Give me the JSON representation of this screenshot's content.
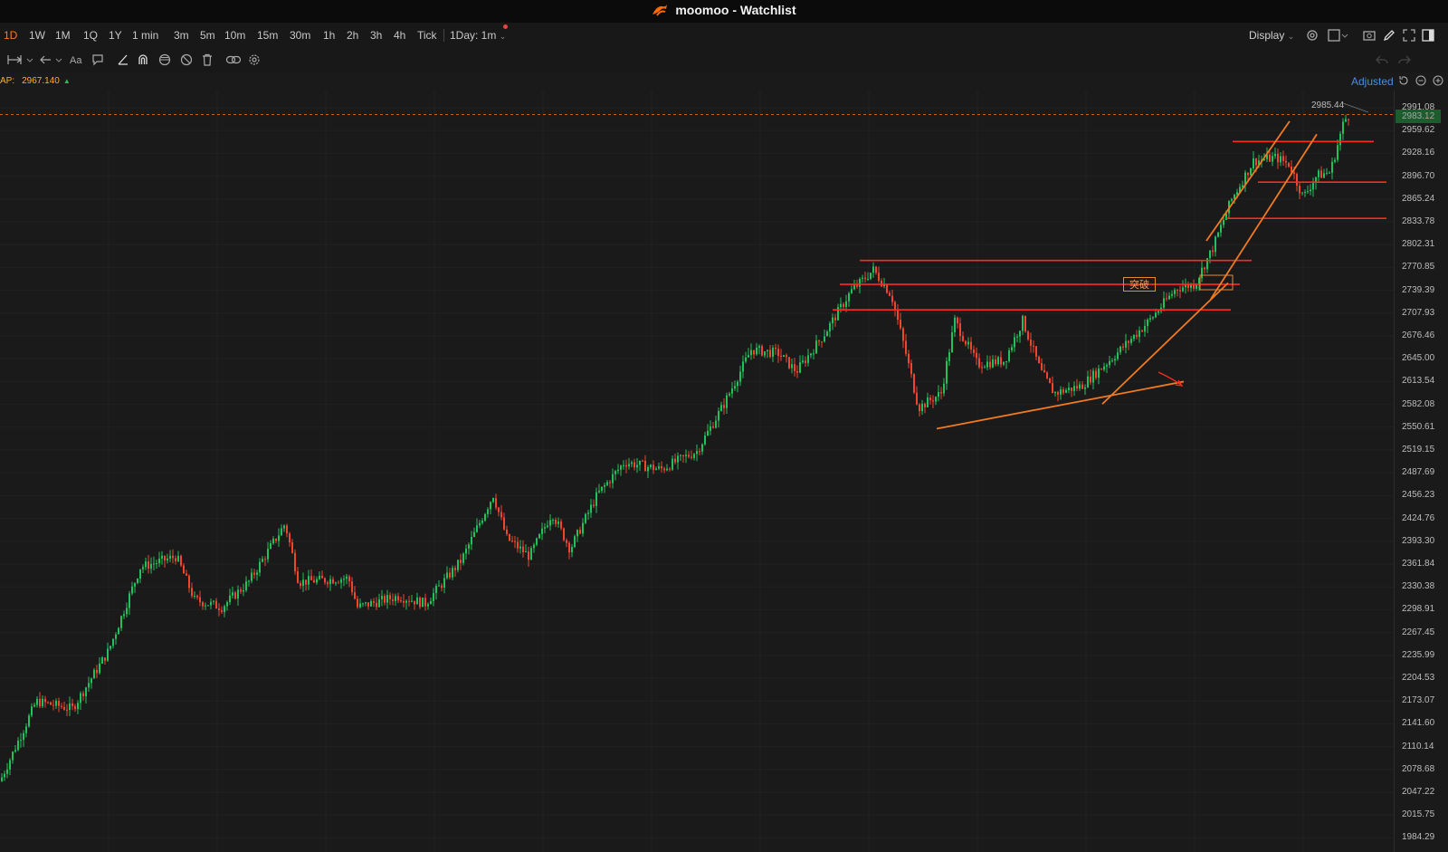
{
  "window": {
    "app_name": "moomoo",
    "title": "moomoo - Watchlist"
  },
  "timeframes": [
    {
      "label": "1D",
      "active": true
    },
    {
      "label": "1W"
    },
    {
      "label": "1M"
    },
    {
      "label": "1Q"
    },
    {
      "label": "1Y"
    },
    {
      "label": "1 min"
    },
    {
      "label": "3m"
    },
    {
      "label": "5m"
    },
    {
      "label": "10m"
    },
    {
      "label": "15m"
    },
    {
      "label": "30m"
    },
    {
      "label": "1h"
    },
    {
      "label": "2h"
    },
    {
      "label": "3h"
    },
    {
      "label": "4h"
    },
    {
      "label": "Tick"
    }
  ],
  "interval_select": {
    "label": "1Day: 1m"
  },
  "display_menu": {
    "label": "Display"
  },
  "drawing_tools": [
    "measure-icon",
    "arrow-icon",
    "text-icon",
    "comment-icon",
    "trendline-icon",
    "magnet-icon",
    "channel-icon",
    "hide-icon",
    "delete-icon",
    "link-icon",
    "settings-icon"
  ],
  "indicator": {
    "label": "AP:",
    "value": "2967.140",
    "direction": "up"
  },
  "adjust_label": "Adjusted",
  "price_axis": {
    "ticks": [
      "2991.08",
      "2959.62",
      "2928.16",
      "2896.70",
      "2865.24",
      "2833.78",
      "2802.31",
      "2770.85",
      "2739.39",
      "2707.93",
      "2676.46",
      "2645.00",
      "2613.54",
      "2582.08",
      "2550.61",
      "2519.15",
      "2487.69",
      "2456.23",
      "2424.76",
      "2393.30",
      "2361.84",
      "2330.38",
      "2298.91",
      "2267.45",
      "2235.99",
      "2204.53",
      "2173.07",
      "2141.60",
      "2110.14",
      "2078.68",
      "2047.22",
      "2015.75",
      "1984.29"
    ],
    "last_price": "2983.12",
    "high_marker": "2985.44"
  },
  "annotation": {
    "text": "突破"
  },
  "colors": {
    "up": "#21c25c",
    "down": "#f0462e",
    "trendline": "#f07a20",
    "support": "#ff2a1f",
    "accent": "#ff7a1a"
  },
  "chart_data": {
    "type": "candlestick",
    "ylim": [
      1984.29,
      2991.08
    ],
    "grid": true,
    "price_path": [
      {
        "x": 0,
        "y": 2065
      },
      {
        "x": 40,
        "y": 2175
      },
      {
        "x": 80,
        "y": 2165
      },
      {
        "x": 120,
        "y": 2245
      },
      {
        "x": 155,
        "y": 2360
      },
      {
        "x": 195,
        "y": 2375
      },
      {
        "x": 215,
        "y": 2315
      },
      {
        "x": 245,
        "y": 2305
      },
      {
        "x": 275,
        "y": 2340
      },
      {
        "x": 315,
        "y": 2420
      },
      {
        "x": 330,
        "y": 2340
      },
      {
        "x": 385,
        "y": 2345
      },
      {
        "x": 395,
        "y": 2305
      },
      {
        "x": 440,
        "y": 2320
      },
      {
        "x": 470,
        "y": 2310
      },
      {
        "x": 510,
        "y": 2370
      },
      {
        "x": 545,
        "y": 2460
      },
      {
        "x": 560,
        "y": 2400
      },
      {
        "x": 585,
        "y": 2375
      },
      {
        "x": 610,
        "y": 2435
      },
      {
        "x": 630,
        "y": 2385
      },
      {
        "x": 660,
        "y": 2460
      },
      {
        "x": 690,
        "y": 2505
      },
      {
        "x": 730,
        "y": 2495
      },
      {
        "x": 770,
        "y": 2520
      },
      {
        "x": 800,
        "y": 2585
      },
      {
        "x": 830,
        "y": 2660
      },
      {
        "x": 860,
        "y": 2655
      },
      {
        "x": 880,
        "y": 2630
      },
      {
        "x": 910,
        "y": 2680
      },
      {
        "x": 940,
        "y": 2740
      },
      {
        "x": 965,
        "y": 2770
      },
      {
        "x": 985,
        "y": 2735
      },
      {
        "x": 1000,
        "y": 2660
      },
      {
        "x": 1015,
        "y": 2580
      },
      {
        "x": 1040,
        "y": 2600
      },
      {
        "x": 1055,
        "y": 2700
      },
      {
        "x": 1080,
        "y": 2640
      },
      {
        "x": 1110,
        "y": 2645
      },
      {
        "x": 1130,
        "y": 2700
      },
      {
        "x": 1150,
        "y": 2630
      },
      {
        "x": 1165,
        "y": 2600
      },
      {
        "x": 1195,
        "y": 2610
      },
      {
        "x": 1230,
        "y": 2650
      },
      {
        "x": 1270,
        "y": 2700
      },
      {
        "x": 1300,
        "y": 2745
      },
      {
        "x": 1320,
        "y": 2750
      },
      {
        "x": 1340,
        "y": 2800
      },
      {
        "x": 1360,
        "y": 2865
      },
      {
        "x": 1385,
        "y": 2920
      },
      {
        "x": 1410,
        "y": 2925
      },
      {
        "x": 1425,
        "y": 2915
      },
      {
        "x": 1440,
        "y": 2870
      },
      {
        "x": 1455,
        "y": 2900
      },
      {
        "x": 1470,
        "y": 2905
      },
      {
        "x": 1485,
        "y": 2975
      },
      {
        "x": 1490,
        "y": 2983
      }
    ],
    "horizontal_levels": [
      {
        "y": 2783,
        "x_from": 950,
        "x_to": 1383
      },
      {
        "y": 2750,
        "x_from": 928,
        "x_to": 1370
      },
      {
        "y": 2715,
        "x_from": 920,
        "x_to": 1360
      },
      {
        "y": 2947,
        "x_from": 1362,
        "x_to": 1518
      },
      {
        "y": 2891,
        "x_from": 1390,
        "x_to": 1532
      },
      {
        "y": 2841,
        "x_from": 1355,
        "x_to": 1532
      }
    ],
    "trendlines": [
      {
        "x1": 1035,
        "y1": 2551,
        "x2": 1308,
        "y2": 2616
      },
      {
        "x1": 1218,
        "y1": 2585,
        "x2": 1357,
        "y2": 2752
      },
      {
        "x1": 1333,
        "y1": 2810,
        "x2": 1425,
        "y2": 2975
      },
      {
        "x1": 1338,
        "y1": 2730,
        "x2": 1455,
        "y2": 2957
      }
    ]
  }
}
